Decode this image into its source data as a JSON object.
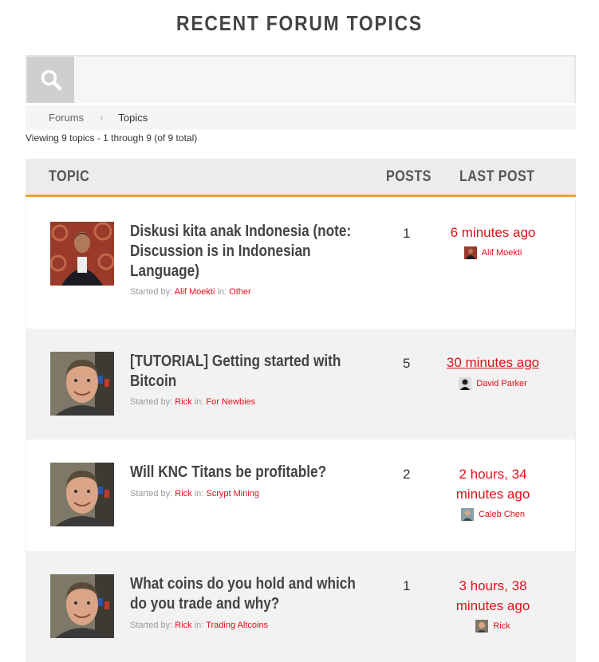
{
  "page": {
    "title": "RECENT FORUM TOPICS"
  },
  "search": {
    "placeholder": "",
    "icon": "search-icon"
  },
  "breadcrumb": {
    "items": [
      "Forums",
      "Topics"
    ],
    "separator": "›"
  },
  "viewing": "Viewing 9 topics - 1 through 9 (of 9 total)",
  "table": {
    "headers": {
      "topic": "TOPIC",
      "posts": "POSTS",
      "last_post": "LAST POST"
    }
  },
  "labels": {
    "started_by": "Started by:",
    "in": "in:"
  },
  "topics": [
    {
      "title": "Diskusi kita anak Indonesia (note: Discussion is in Indonesian Language)",
      "author": "Alif Moekti",
      "forum": "Other",
      "posts": "1",
      "last_post_time": "6 minutes ago",
      "last_post_user": "Alif Moekti"
    },
    {
      "title": "[TUTORIAL] Getting started with Bitcoin",
      "author": "Rick",
      "forum": "For Newbies",
      "posts": "5",
      "last_post_time": "30 minutes ago",
      "last_post_user": "David Parker"
    },
    {
      "title": "Will KNC Titans be profitable?",
      "author": "Rick",
      "forum": "Scrypt Mining",
      "posts": "2",
      "last_post_time": "2 hours, 34 minutes ago",
      "last_post_user": "Caleb Chen"
    },
    {
      "title": "What coins do you hold and which do you trade and why?",
      "author": "Rick",
      "forum": "Trading Altcoins",
      "posts": "1",
      "last_post_time": "3 hours, 38 minutes ago",
      "last_post_user": "Rick"
    }
  ],
  "colors": {
    "accent": "#f0a030",
    "link": "#e0101a",
    "row_alt": "#f2f2f2"
  }
}
